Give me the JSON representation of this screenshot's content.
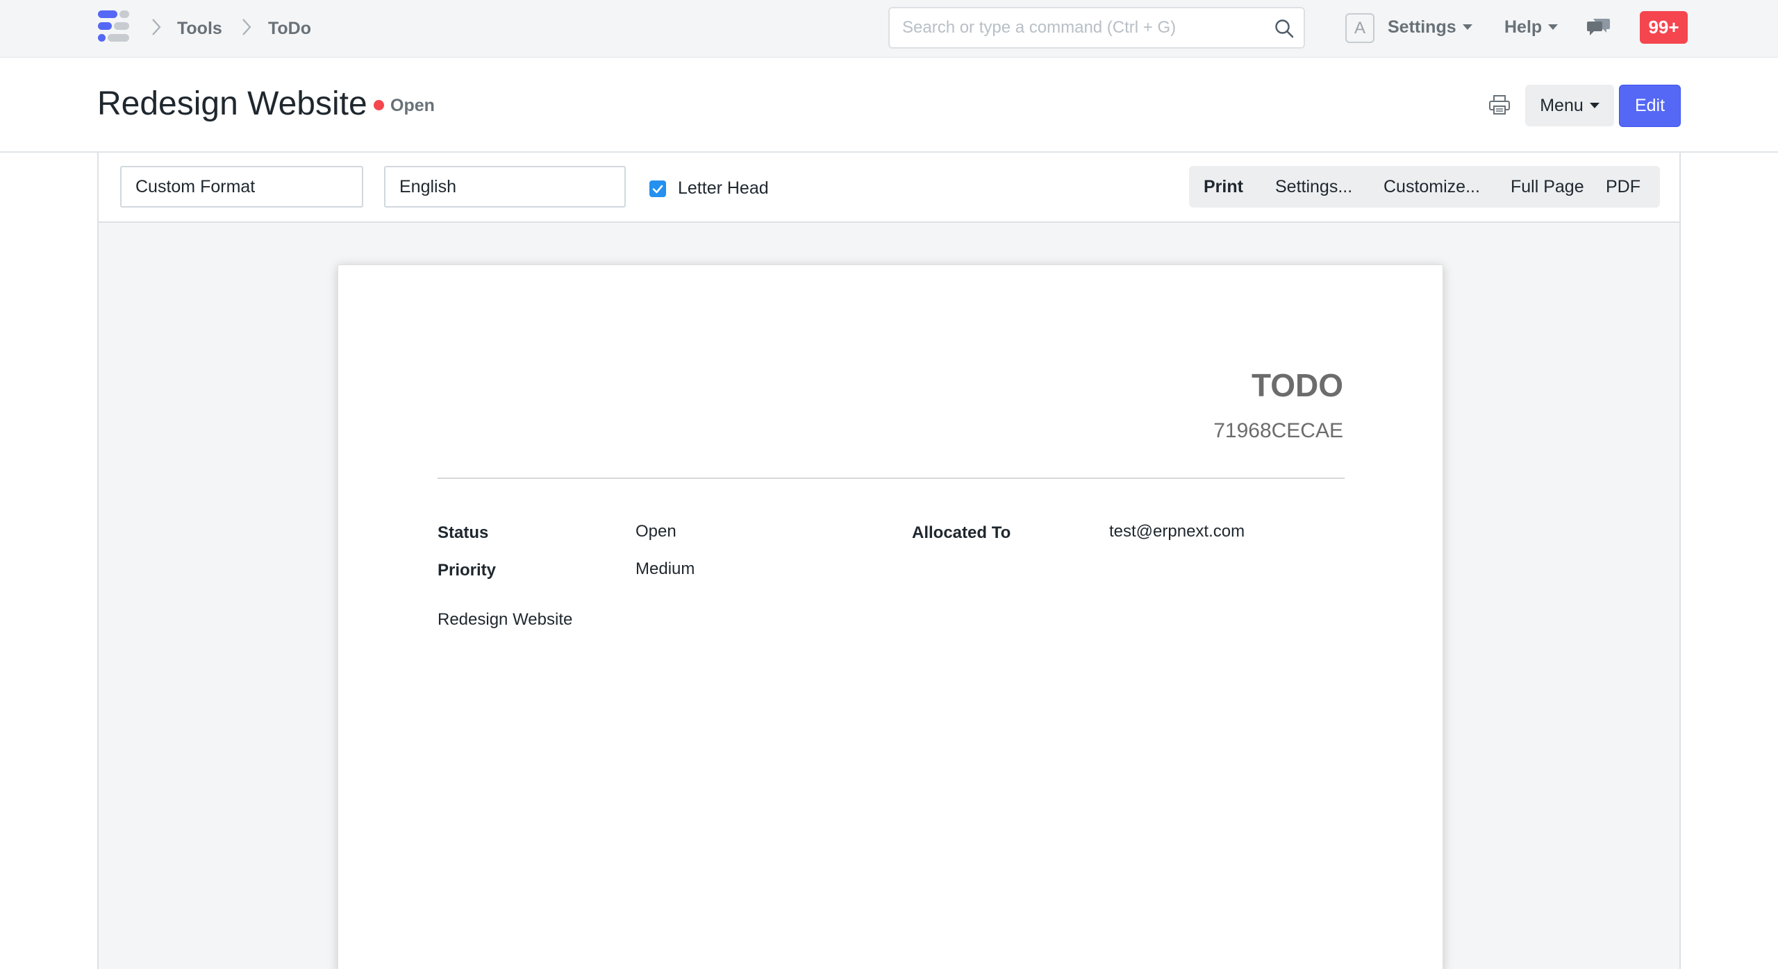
{
  "navbar": {
    "breadcrumbs": [
      "Tools",
      "ToDo"
    ],
    "search_placeholder": "Search or type a command (Ctrl + G)",
    "avatar_letter": "A",
    "settings_label": "Settings",
    "help_label": "Help",
    "notification_count": "99+",
    "icons": [
      "app-logo-icon",
      "chevron-right-icon",
      "search-icon",
      "chat-icon"
    ]
  },
  "page_head": {
    "title": "Redesign Website",
    "status": "Open",
    "status_color": "#f5454f",
    "menu_label": "Menu",
    "edit_label": "Edit",
    "accent_color": "#5468f5"
  },
  "print_toolbar": {
    "format_value": "Custom Format",
    "language_value": "English",
    "letter_head_label": "Letter Head",
    "letter_head_checked": true,
    "actions": [
      "Print",
      "Settings...",
      "Customize...",
      "Full Page",
      "PDF"
    ]
  },
  "document": {
    "heading": "TODO",
    "doc_id": "71968CECAE",
    "fields": {
      "status_label": "Status",
      "status_value": "Open",
      "priority_label": "Priority",
      "priority_value": "Medium",
      "allocated_label": "Allocated To",
      "allocated_value": "test@erpnext.com"
    },
    "description": "Redesign Website"
  }
}
